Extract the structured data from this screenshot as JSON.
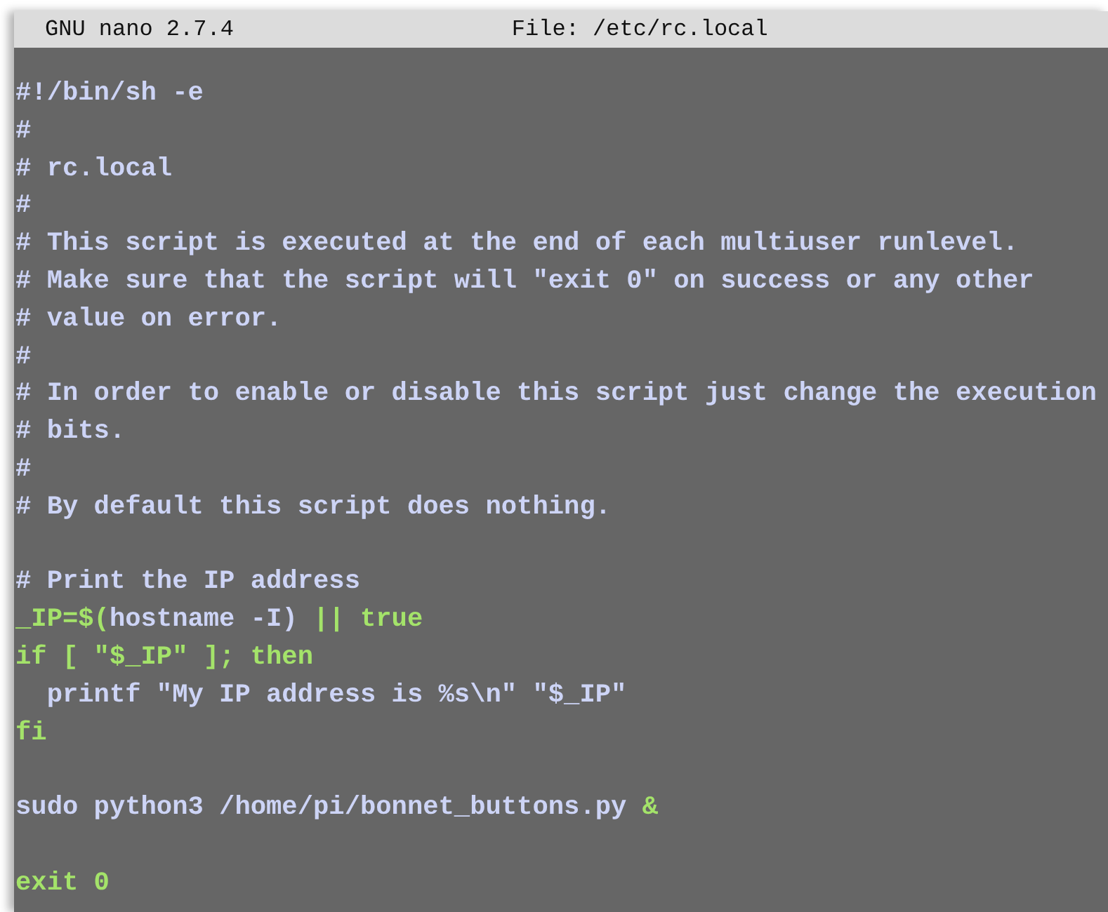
{
  "title_bar": {
    "program": "GNU nano 2.7.4",
    "file": "File: /etc/rc.local"
  },
  "lines": [
    {
      "kind": "text",
      "segments": [
        {
          "text": "#!/bin/sh -e",
          "kind": "plain"
        }
      ]
    },
    {
      "kind": "text",
      "segments": [
        {
          "text": "#",
          "kind": "plain"
        }
      ]
    },
    {
      "kind": "text",
      "segments": [
        {
          "text": "# rc.local",
          "kind": "plain"
        }
      ]
    },
    {
      "kind": "text",
      "segments": [
        {
          "text": "#",
          "kind": "plain"
        }
      ]
    },
    {
      "kind": "text",
      "segments": [
        {
          "text": "# This script is executed at the end of each multiuser runlevel.",
          "kind": "plain"
        }
      ]
    },
    {
      "kind": "text",
      "segments": [
        {
          "text": "# Make sure that the script will \"exit 0\" on success or any other",
          "kind": "plain"
        }
      ]
    },
    {
      "kind": "text",
      "segments": [
        {
          "text": "# value on error.",
          "kind": "plain"
        }
      ]
    },
    {
      "kind": "text",
      "segments": [
        {
          "text": "#",
          "kind": "plain"
        }
      ]
    },
    {
      "kind": "text",
      "segments": [
        {
          "text": "# In order to enable or disable this script just change the execution",
          "kind": "plain"
        }
      ]
    },
    {
      "kind": "text",
      "segments": [
        {
          "text": "# bits.",
          "kind": "plain"
        }
      ]
    },
    {
      "kind": "text",
      "segments": [
        {
          "text": "#",
          "kind": "plain"
        }
      ]
    },
    {
      "kind": "text",
      "segments": [
        {
          "text": "# By default this script does nothing.",
          "kind": "plain"
        }
      ]
    },
    {
      "kind": "blank"
    },
    {
      "kind": "text",
      "segments": [
        {
          "text": "# Print the IP address",
          "kind": "plain"
        }
      ]
    },
    {
      "kind": "text",
      "segments": [
        {
          "text": "_IP=$(",
          "kind": "keyword"
        },
        {
          "text": "hostname -I) ",
          "kind": "plain"
        },
        {
          "text": "|| true",
          "kind": "keyword"
        }
      ]
    },
    {
      "kind": "text",
      "segments": [
        {
          "text": "if [ \"$_IP\" ]; then",
          "kind": "keyword"
        }
      ]
    },
    {
      "kind": "text",
      "segments": [
        {
          "text": "  printf \"My IP address is %s\\n\" \"$_IP\"",
          "kind": "plain"
        }
      ]
    },
    {
      "kind": "text",
      "segments": [
        {
          "text": "fi",
          "kind": "keyword"
        }
      ]
    },
    {
      "kind": "blank"
    },
    {
      "kind": "text",
      "segments": [
        {
          "text": "sudo python3 /home/pi/bonnet_buttons.py ",
          "kind": "plain"
        },
        {
          "text": "&",
          "kind": "keyword"
        }
      ]
    },
    {
      "kind": "blank"
    },
    {
      "kind": "text",
      "segments": [
        {
          "text": "exit 0",
          "kind": "keyword"
        }
      ]
    }
  ]
}
